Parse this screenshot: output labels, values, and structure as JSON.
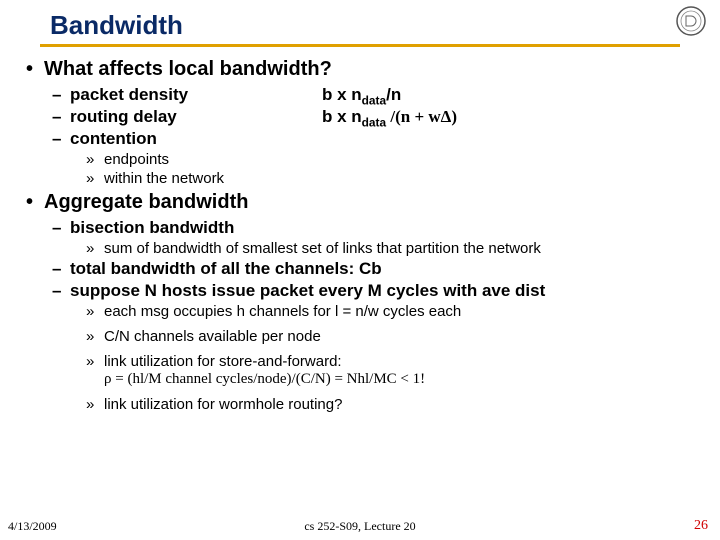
{
  "title": "Bandwidth",
  "q1": "What affects local bandwidth?",
  "pd": "packet density",
  "pd_rhs_pre": "b x n",
  "pd_rhs_sub": "data",
  "pd_rhs_post": "/n",
  "rd": "routing delay",
  "rd_rhs_pre": "b x n",
  "rd_rhs_sub": "data",
  "rd_rhs_post": " /(n + wΔ)",
  "cont": "contention",
  "ep": "endpoints",
  "wn": "within the network",
  "agg": "Aggregate bandwidth",
  "bis": "bisection bandwidth",
  "bis_sub": "sum of bandwidth of smallest set of links that partition the network",
  "tot": "total bandwidth of all the channels: Cb",
  "sup": "suppose N hosts issue packet every M cycles with ave dist",
  "msg": "each msg occupies h channels for l = n/w cycles each",
  "cn": "C/N channels available per node",
  "sf1": "link utilization for store-and-forward:",
  "sf2": " ρ = (hl/M channel cycles/node)/(C/N) = Nhl/MC < 1!",
  "wh": "link utilization for wormhole routing?",
  "footer_date": "4/13/2009",
  "footer_center": "cs 252-S09, Lecture 20",
  "footer_page": "26"
}
